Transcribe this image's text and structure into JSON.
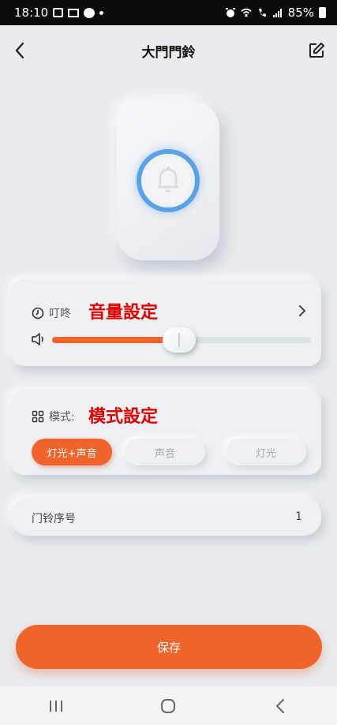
{
  "status_bar": {
    "time": "18:10",
    "battery": "85%",
    "signal_text": "Vo LTE"
  },
  "header": {
    "title": "大門門鈴",
    "back_icon": "chevron-left-icon",
    "edit_icon": "edit-icon"
  },
  "volume": {
    "label": "叮咚",
    "annotation": "音量設定",
    "level_percent": 49,
    "colors": {
      "fill": "#f0642b",
      "track": "#dde0e5"
    }
  },
  "mode": {
    "label": "模式:",
    "annotation": "模式設定",
    "options": [
      {
        "label": "灯光+声音",
        "selected": true
      },
      {
        "label": "声音",
        "selected": false
      },
      {
        "label": "灯光",
        "selected": false
      }
    ]
  },
  "serial": {
    "label": "门铃序号",
    "value": "1"
  },
  "save_button": {
    "label": "保存"
  },
  "colors": {
    "accent": "#f0642b",
    "ring": "#5aa2e8",
    "annotation_red": "#e00000"
  }
}
